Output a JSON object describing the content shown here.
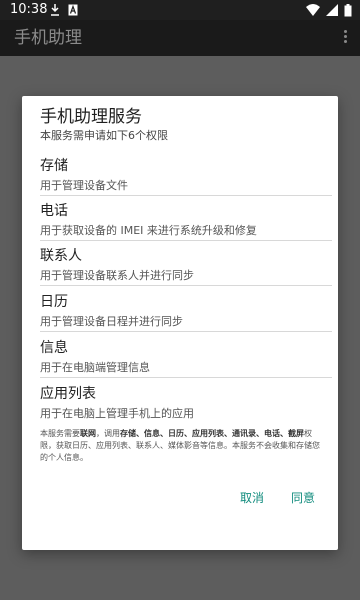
{
  "status_bar": {
    "time": "10:38",
    "left_icons": [
      "download-icon",
      "a-notification-icon"
    ],
    "right_icons": [
      "wifi-icon",
      "signal-icon",
      "battery-icon"
    ]
  },
  "app_bar": {
    "title": "手机助理",
    "menu_icon": "overflow-menu-icon"
  },
  "dialog": {
    "title": "手机助理服务",
    "subtitle": "本服务需申请如下6个权限",
    "permissions": [
      {
        "name": "存储",
        "description": "用于管理设备文件"
      },
      {
        "name": "电话",
        "description": "用于获取设备的 IMEI 来进行系统升级和修复"
      },
      {
        "name": "联系人",
        "description": "用于管理设备联系人并进行同步"
      },
      {
        "name": "日历",
        "description": "用于管理设备日程并进行同步"
      },
      {
        "name": "信息",
        "description": "用于在电脑端管理信息"
      },
      {
        "name": "应用列表",
        "description": "用于在电脑上管理手机上的应用"
      }
    ],
    "notice": {
      "part1": "本服务需要",
      "bold1": "联网",
      "part2": "，调用",
      "bold2": "存储、信息、日历、应用列表、通讯录、电话、截屏",
      "part3": "权限，获取日历、应用列表、联系人、媒体影音等信息。本服务不会收集和存储您的个人信息。"
    },
    "buttons": {
      "cancel": "取消",
      "agree": "同意"
    },
    "accent_color": "#128c7e"
  },
  "colors": {
    "status_bar": "#1f1f1f",
    "app_bar": "#1a1a1a",
    "scrim": "#5d5d5d",
    "dialog_bg": "#ffffff"
  }
}
